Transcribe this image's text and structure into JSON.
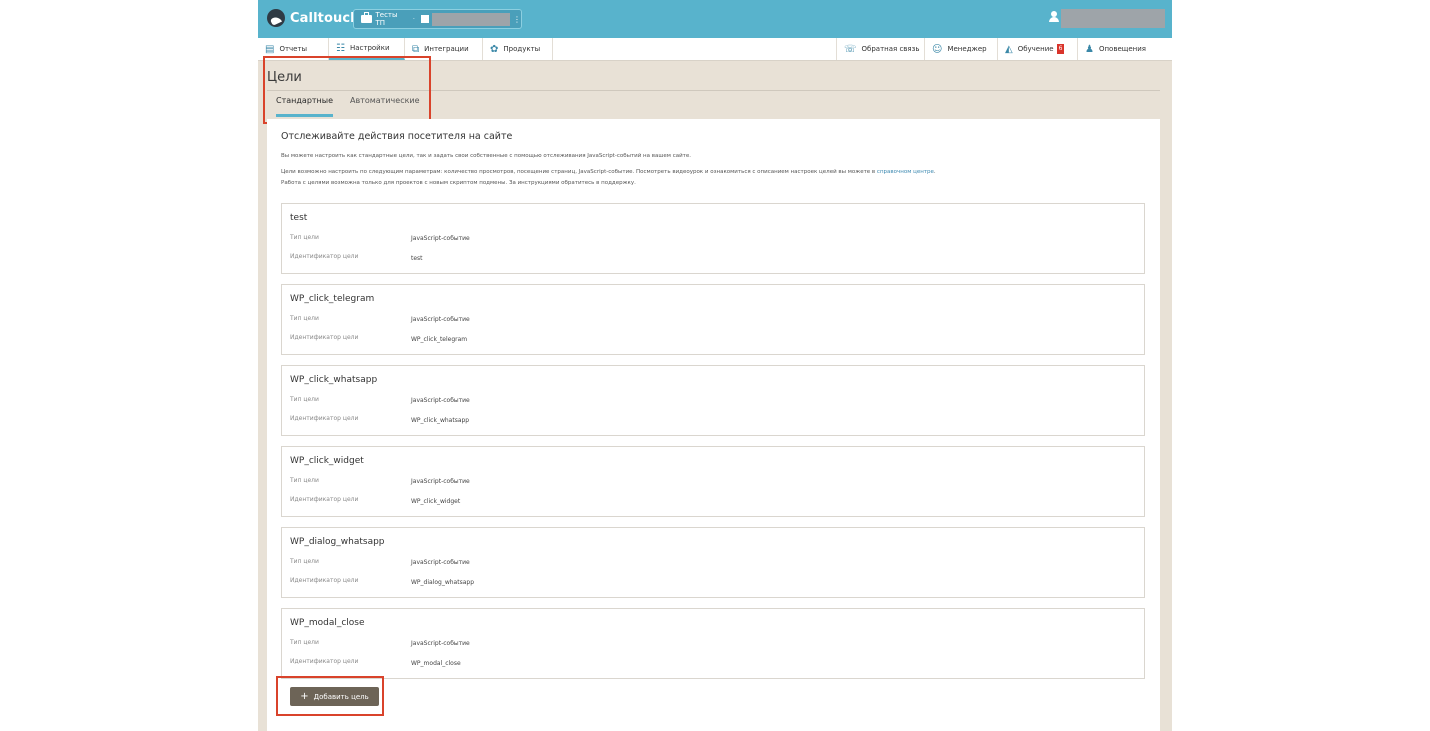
{
  "header": {
    "brand": "Calltouch",
    "project_label": "Тесты ТП",
    "project_separator": "·",
    "more_glyph": "⋮"
  },
  "menu": {
    "left": [
      {
        "label": "Отчеты",
        "icon": "report-icon"
      },
      {
        "label": "Настройки",
        "icon": "settings-icon",
        "active": true
      },
      {
        "label": "Интеграции",
        "icon": "integrations-icon"
      },
      {
        "label": "Продукты",
        "icon": "products-icon"
      }
    ],
    "right": [
      {
        "label": "Обратная связь",
        "icon": "feedback-icon"
      },
      {
        "label": "Менеджер",
        "icon": "manager-icon"
      },
      {
        "label": "Обучение",
        "icon": "education-icon",
        "badge": "6"
      },
      {
        "label": "Оповещения",
        "icon": "bell-icon"
      }
    ]
  },
  "page": {
    "title": "Цели",
    "tabs": [
      {
        "label": "Стандартные",
        "active": true
      },
      {
        "label": "Автоматические",
        "active": false
      }
    ]
  },
  "intro": {
    "title": "Отслеживайте действия посетителя на сайте",
    "p1": "Вы можете настроить как стандартные цели, так и задать свои собственные с помощью отслеживания JavaScript-событий на вашем сайте.",
    "p2_text": "Цели возможно настроить по следующим параметрам: количество просмотров, посещение страниц, JavaScript-событие. Посмотреть видеоурок и ознакомиться с описанием настроек целей вы можете в ",
    "p2_link": "справочном центре",
    "p2_end": ".",
    "p3": "Работа с целями возможна только для проектов с новым скриптом подмены. За инструкциями обратитесь в поддержку."
  },
  "goals": {
    "type_key": "Тип цели",
    "id_key": "Идентификатор цели",
    "items": [
      {
        "name": "test",
        "type": "JavaScript-событие",
        "id": "test"
      },
      {
        "name": "WP_click_telegram",
        "type": "JavaScript-событие",
        "id": "WP_click_telegram"
      },
      {
        "name": "WP_click_whatsapp",
        "type": "JavaScript-событие",
        "id": "WP_click_whatsapp"
      },
      {
        "name": "WP_click_widget",
        "type": "JavaScript-событие",
        "id": "WP_click_widget"
      },
      {
        "name": "WP_dialog_whatsapp",
        "type": "JavaScript-событие",
        "id": "WP_dialog_whatsapp"
      },
      {
        "name": "WP_modal_close",
        "type": "JavaScript-событие",
        "id": "WP_modal_close"
      }
    ]
  },
  "add_button": {
    "plus": "+",
    "label": "Добавить цель"
  },
  "colors": {
    "header": "#58b3cc",
    "background": "#e8e1d6",
    "highlight": "#d9432b",
    "button": "#6d6457"
  }
}
